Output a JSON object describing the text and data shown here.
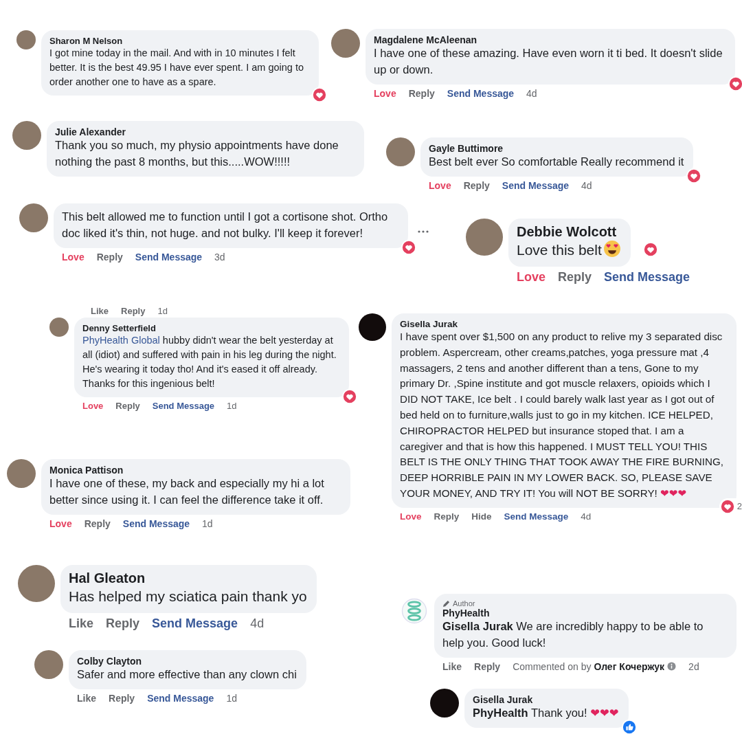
{
  "comments": [
    {
      "kind": "comment",
      "name": "Sharon M Nelson",
      "text": "I got mine today in the mail. And with in 10 minutes I felt better. It is the best 49.95 I have ever spent. I am going to order another one to have as a spare.",
      "reaction": {
        "kind": "love"
      }
    },
    {
      "kind": "comment",
      "name": "Julie Alexander",
      "text": "Thank you so much, my physio appointments have done nothing the past 8 months, but this.....WOW!!!!!"
    },
    {
      "kind": "comment",
      "name": "Magdalene McAleenan",
      "text": "I have one of these amazing. Have even worn it ti bed. It doesn't slide up or down.",
      "reaction": {
        "kind": "love"
      },
      "actions": [
        {
          "label": "Love",
          "kind": "love"
        },
        {
          "label": "Reply",
          "kind": "plain"
        },
        {
          "label": "Send Message",
          "kind": "link"
        },
        {
          "label": "4d",
          "kind": "time"
        }
      ]
    },
    {
      "kind": "comment",
      "name": "Gayle Buttimore",
      "text": "Best belt ever So comfortable Really recommend it",
      "reaction": {
        "kind": "love"
      },
      "actions": [
        {
          "label": "Love",
          "kind": "love"
        },
        {
          "label": "Reply",
          "kind": "plain"
        },
        {
          "label": "Send Message",
          "kind": "link"
        },
        {
          "label": "4d",
          "kind": "time"
        }
      ]
    },
    {
      "kind": "comment",
      "text": "This belt allowed me to function until I got a cortisone shot. Ortho doc liked it's thin, not huge. and not bulky. I'll keep it forever!",
      "reaction": {
        "kind": "love"
      },
      "actions": [
        {
          "label": "Love",
          "kind": "love"
        },
        {
          "label": "Reply",
          "kind": "plain"
        },
        {
          "label": "Send Message",
          "kind": "link"
        },
        {
          "label": "3d",
          "kind": "time"
        }
      ]
    },
    {
      "kind": "actions_only",
      "actions": [
        {
          "label": "Like",
          "kind": "plain"
        },
        {
          "label": "Reply",
          "kind": "plain"
        },
        {
          "label": "1d",
          "kind": "time"
        }
      ]
    },
    {
      "kind": "comment",
      "name": "Denny Setterfield",
      "mention": "PhyHealth Global",
      "text": "hubby didn't wear the belt yesterday at all (idiot) and suffered with pain in his leg during the night. He's wearing it today tho! And it's eased it off already. Thanks for this ingenious belt!",
      "reaction": {
        "kind": "love"
      },
      "actions": [
        {
          "label": "Love",
          "kind": "love"
        },
        {
          "label": "Reply",
          "kind": "plain"
        },
        {
          "label": "Send Message",
          "kind": "link"
        },
        {
          "label": "1d",
          "kind": "time"
        }
      ]
    },
    {
      "kind": "comment",
      "name": "Debbie Wolcott",
      "text": "Love this belt",
      "emoji": {
        "kind": "heart_eyes"
      },
      "reaction": {
        "kind": "love"
      },
      "actions": [
        {
          "label": "Love",
          "kind": "love"
        },
        {
          "label": "Reply",
          "kind": "plain"
        },
        {
          "label": "Send Message",
          "kind": "link"
        }
      ]
    },
    {
      "kind": "comment",
      "name": "Gisella Jurak",
      "text": "I have spent over $1,500 on any product to relive my 3 separated disc problem. Aspercream, other creams,patches, yoga pressure mat ,4 massagers, 2 tens and another different than a tens, Gone to my primary Dr. ,Spine institute and got muscle relaxers, opioids which I DID NOT TAKE, Ice belt . I could barely walk last year as I got out of bed held on to furniture,walls just to go in my kitchen. ICE HELPED, CHIROPRACTOR HELPED but insurance stoped that. I am a caregiver and that is how this happened. I MUST TELL YOU! THIS BELT IS THE ONLY THING THAT TOOK AWAY THE FIRE BURNING, DEEP HORRIBLE PAIN IN MY LOWER BACK. SO, PLEASE SAVE YOUR MONEY, AND TRY IT! You will NOT BE SORRY!",
      "hearts": "❤❤❤",
      "reaction": {
        "kind": "love",
        "count": "2"
      },
      "actions": [
        {
          "label": "Love",
          "kind": "love"
        },
        {
          "label": "Reply",
          "kind": "plain"
        },
        {
          "label": "Hide",
          "kind": "plain"
        },
        {
          "label": "Send Message",
          "kind": "link"
        },
        {
          "label": "4d",
          "kind": "time"
        }
      ]
    },
    {
      "kind": "comment",
      "badge": "Author",
      "name": "PhyHealth",
      "text": "**Gisella Jurak** We are incredibly happy to be able to help you. Good luck!",
      "actions": [
        {
          "label": "Like",
          "kind": "plain"
        },
        {
          "label": "Reply",
          "kind": "plain"
        },
        {
          "label": "Commented on by **Олег Кочержук**",
          "kind": "note"
        },
        {
          "label": "2d",
          "kind": "time"
        }
      ]
    },
    {
      "kind": "comment",
      "name": "Gisella Jurak",
      "text": "**PhyHealth** Thank you!",
      "hearts": "❤❤❤",
      "reaction": {
        "kind": "like"
      }
    },
    {
      "kind": "comment",
      "name": "Monica Pattison",
      "text": "I have one of these, my back and especially my hi a lot better since using it. I can feel the difference take it off.",
      "actions": [
        {
          "label": "Love",
          "kind": "love"
        },
        {
          "label": "Reply",
          "kind": "plain"
        },
        {
          "label": "Send Message",
          "kind": "link"
        },
        {
          "label": "1d",
          "kind": "time"
        }
      ]
    },
    {
      "kind": "comment",
      "name": "Hal Gleaton",
      "text": "Has helped my sciatica pain thank yo",
      "actions": [
        {
          "label": "Like",
          "kind": "plain"
        },
        {
          "label": "Reply",
          "kind": "plain"
        },
        {
          "label": "Send Message",
          "kind": "link"
        },
        {
          "label": "4d",
          "kind": "time"
        }
      ]
    },
    {
      "kind": "comment",
      "name": "Colby Clayton",
      "text": "Safer and more effective than any clown chi",
      "actions": [
        {
          "label": "Like",
          "kind": "plain"
        },
        {
          "label": "Reply",
          "kind": "plain"
        },
        {
          "label": "Send Message",
          "kind": "link"
        },
        {
          "label": "1d",
          "kind": "time"
        }
      ]
    }
  ]
}
